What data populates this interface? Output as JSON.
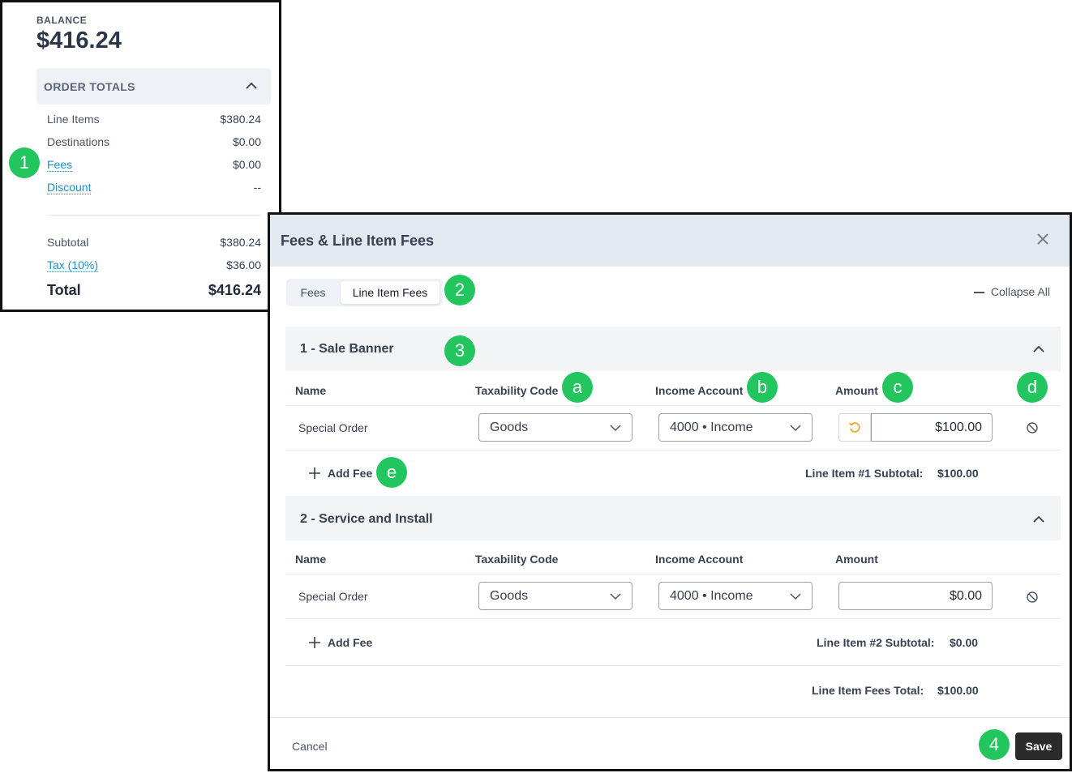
{
  "order_panel": {
    "balance_label": "BALANCE",
    "balance_value": "$416.24",
    "section_title": "ORDER TOTALS",
    "rows": [
      {
        "label": "Line Items",
        "value": "$380.24"
      },
      {
        "label": "Destinations",
        "value": "$0.00"
      },
      {
        "label": "Fees",
        "value": "$0.00"
      },
      {
        "label": "Discount",
        "value": "--"
      }
    ],
    "subtotal": {
      "label": "Subtotal",
      "value": "$380.24"
    },
    "tax": {
      "label": "Tax (10%)",
      "value": "$36.00"
    },
    "total": {
      "label": "Total",
      "value": "$416.24"
    }
  },
  "dialog": {
    "title": "Fees & Line Item Fees",
    "tabs": [
      "Fees",
      "Line Item Fees"
    ],
    "active_tab": "Line Item Fees",
    "collapse_all": "Collapse All",
    "columns": [
      "Name",
      "Taxability Code",
      "Income Account",
      "Amount"
    ],
    "sections": [
      {
        "title": "1 - Sale Banner",
        "rows": [
          {
            "name": "Special Order",
            "taxability": "Goods",
            "account": "4000 • Income",
            "amount": "$100.00"
          }
        ],
        "add_fee": "Add Fee",
        "subtotal_label": "Line Item #1 Subtotal:",
        "subtotal_value": "$100.00"
      },
      {
        "title": "2 - Service and Install",
        "rows": [
          {
            "name": "Special Order",
            "taxability": "Goods",
            "account": "4000 • Income",
            "amount": "$0.00"
          }
        ],
        "add_fee": "Add Fee",
        "subtotal_label": "Line Item #2 Subtotal:",
        "subtotal_value": "$0.00"
      }
    ],
    "fees_total_label": "Line Item Fees Total:",
    "fees_total_value": "$100.00",
    "cancel": "Cancel",
    "save": "Save"
  },
  "callouts": [
    "1",
    "2",
    "3",
    "4",
    "a",
    "b",
    "c",
    "d",
    "e"
  ],
  "colors": {
    "callout": "#22c55e",
    "link": "#1e8fc8",
    "header_bg": "#e3e9f0",
    "save_bg": "#2b2b2b",
    "reset_icon": "#f59e0b"
  }
}
